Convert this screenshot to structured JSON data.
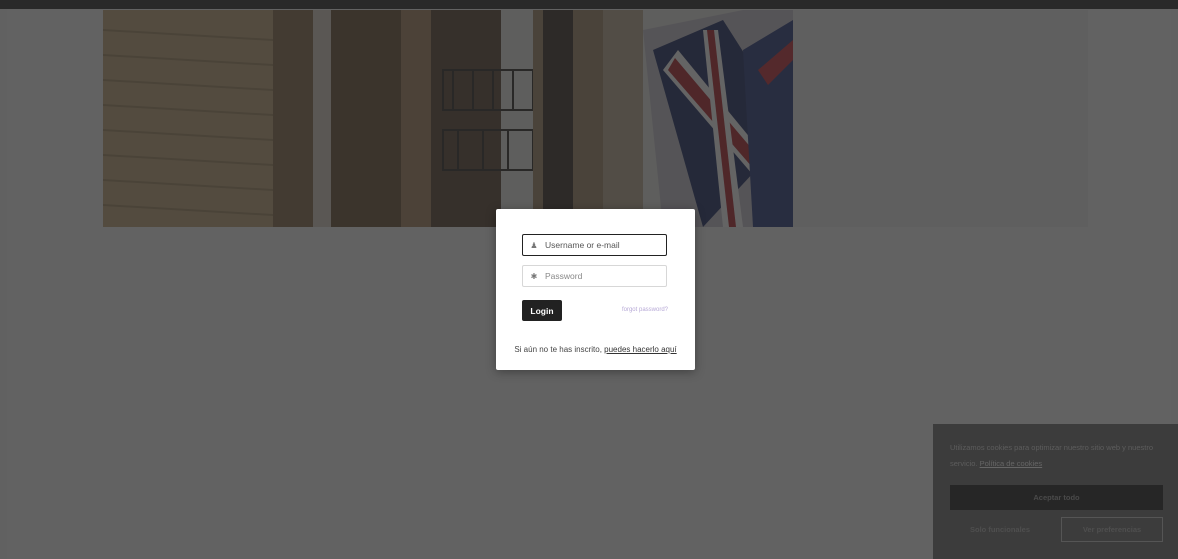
{
  "login": {
    "username_placeholder": "Username or e-mail",
    "password_placeholder": "Password",
    "username_icon": "user-icon",
    "password_icon": "asterisk-icon",
    "login_label": "Login",
    "forgot_label": "forgot password?",
    "register_prefix": "Si aún no te has inscrito, ",
    "register_link": "puedes hacerlo aquí"
  },
  "cookie": {
    "text": "Utilizamos cookies para optimizar nuestro sitio web y nuestro servicio.",
    "policy_link": "Política de cookies",
    "accept_label": "Aceptar todo",
    "functional_label": "Solo funcionales",
    "preferences_label": "Ver preferencias"
  },
  "colors": {
    "topbar": "#2b2b2b",
    "overlay": "rgba(40,40,40,0.72)",
    "login_button": "#222222",
    "forgot_link": "#b6a8d6"
  }
}
